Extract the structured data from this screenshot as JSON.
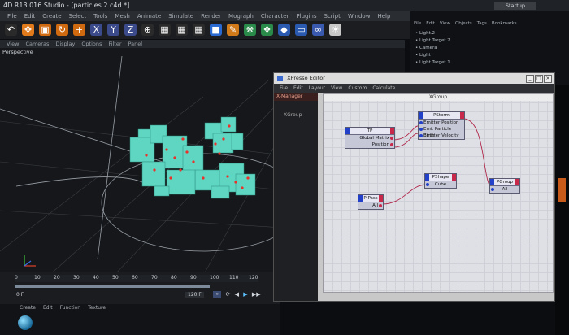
{
  "window": {
    "title": "4D R13.016 Studio - [particles 2.c4d *]",
    "layout_label": "Startup"
  },
  "main_menu": [
    "File",
    "Edit",
    "Create",
    "Select",
    "Tools",
    "Mesh",
    "Animate",
    "Simulate",
    "Render",
    "Mograph",
    "Character",
    "Plugins",
    "Script",
    "Window",
    "Help"
  ],
  "toolbar": {
    "buttons": [
      {
        "icon": "undo-icon",
        "color": "#2a2a2a"
      },
      {
        "icon": "move-icon",
        "color": "#e07a1a"
      },
      {
        "icon": "scale-icon",
        "color": "#d06a10"
      },
      {
        "icon": "rotate-icon",
        "color": "#d06a10"
      },
      {
        "icon": "add-icon",
        "color": "#d06a10"
      },
      {
        "icon": "x-axis-icon",
        "color": "#3a4a8a"
      },
      {
        "icon": "y-axis-icon",
        "color": "#3a4a8a"
      },
      {
        "icon": "z-axis-icon",
        "color": "#3a4a8a"
      },
      {
        "icon": "world-coord-icon",
        "color": "#2a2a2a"
      },
      {
        "icon": "render-region-icon",
        "color": "#2a2a2a"
      },
      {
        "icon": "render-view-icon",
        "color": "#2a2a2a"
      },
      {
        "icon": "render-settings-icon",
        "color": "#2a2a2a"
      },
      {
        "icon": "cube-icon",
        "color": "#2a6ad0"
      },
      {
        "icon": "spline-icon",
        "color": "#d07a1a"
      },
      {
        "icon": "nurbs-icon",
        "color": "#2a8a4a"
      },
      {
        "icon": "array-icon",
        "color": "#2a8a4a"
      },
      {
        "icon": "deformer-icon",
        "color": "#2a5ab0"
      },
      {
        "icon": "scene-icon",
        "color": "#2a5ab0"
      },
      {
        "icon": "camera-icon",
        "color": "#3a5ab0"
      },
      {
        "icon": "light-icon",
        "color": "#c8c8c8"
      }
    ]
  },
  "viewport": {
    "menu": [
      "View",
      "Cameras",
      "Display",
      "Options",
      "Filter",
      "Panel"
    ],
    "label": "Perspective"
  },
  "timeline": {
    "ticks": [
      "0",
      "10",
      "20",
      "30",
      "40",
      "50",
      "60",
      "70",
      "80",
      "90",
      "100",
      "110",
      "120"
    ],
    "current_frame": "0 F",
    "end_frame": "120 F"
  },
  "material_menu": [
    "Create",
    "Edit",
    "Function",
    "Texture"
  ],
  "object_manager": {
    "menu": [
      "File",
      "Edit",
      "View",
      "Objects",
      "Tags",
      "Bookmarks"
    ],
    "objects": [
      "Light.2",
      "Light.Target.2",
      "Camera",
      "Light",
      "Light.Target.1"
    ]
  },
  "xpresso": {
    "title": "XPresso Editor",
    "menu": [
      "File",
      "Edit",
      "Layout",
      "View",
      "Custom",
      "Calculate"
    ],
    "xmanager_label": "X-Manager",
    "xgroup_label": "XGroup",
    "canvas_title": "XGroup",
    "nodes": {
      "tp": {
        "title": "TP",
        "ports": [
          "Global Matrix",
          "Position"
        ]
      },
      "pstorm": {
        "title": "PStorm",
        "ports": [
          "Emitter Position",
          "Emi. Particle Birth",
          "Emitter Velocity"
        ]
      },
      "pshape": {
        "title": "PShape",
        "ports": [
          "Cube"
        ]
      },
      "ppass": {
        "title": "P Pass",
        "ports": [
          "All"
        ]
      },
      "pgroup": {
        "title": "PGroup",
        "ports": [
          "All"
        ]
      }
    }
  },
  "colors": {
    "particles": "#5fd6c2",
    "particle_dots": "#e8322a",
    "port_in": "#2340c8",
    "port_out": "#c8284a",
    "wire": "#b0284a"
  }
}
